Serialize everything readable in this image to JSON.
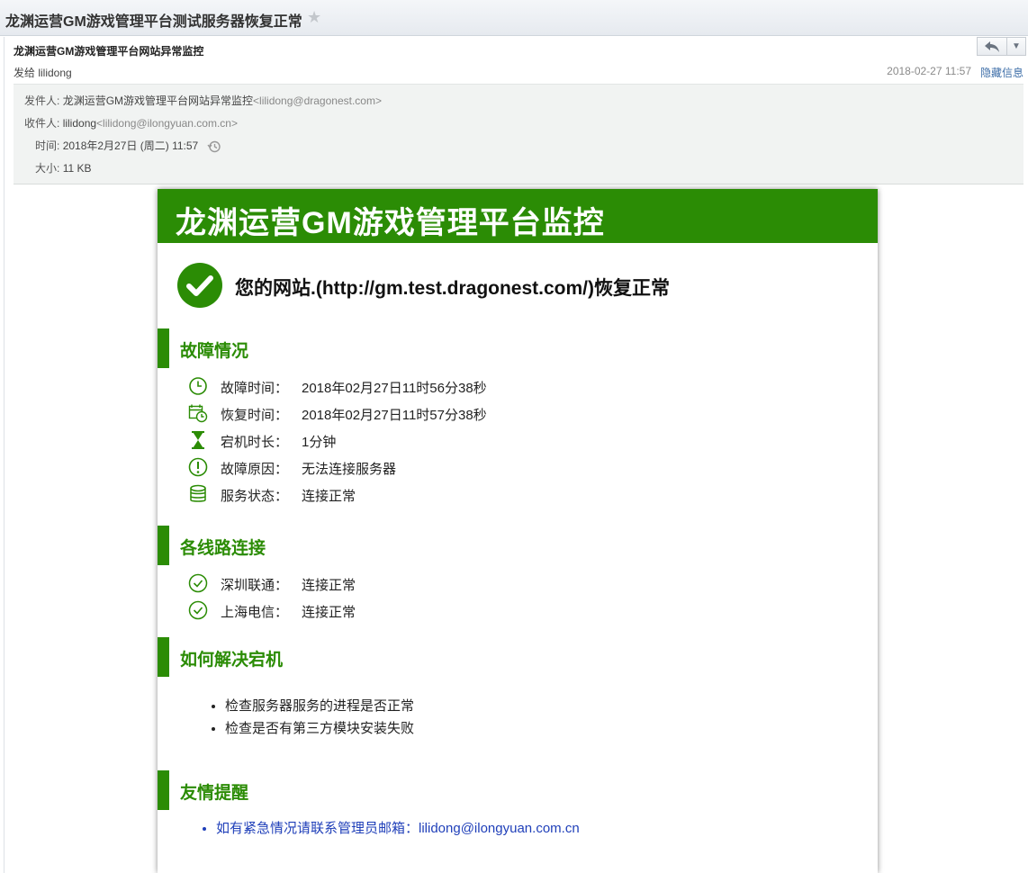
{
  "window": {
    "subject": "龙渊运营GM游戏管理平台测试服务器恢复正常"
  },
  "message": {
    "sender_name": "龙渊运营GM游戏管理平台网站异常监控",
    "recipient_line": "发给 lilidong",
    "date": "2018-02-27 11:57",
    "toggle_details": "隐藏信息"
  },
  "details": {
    "from_label": "发件人:",
    "from_name": "龙渊运营GM游戏管理平台网站异常监控",
    "from_addr": "<lilidong@dragonest.com>",
    "to_label": "收件人:",
    "to_name": "lilidong",
    "to_addr": "<lilidong@ilongyuan.com.cn>",
    "time_label": "时间:",
    "time_value": "2018年2月27日 (周二) 11:57",
    "size_label": "大小:",
    "size_value": "11 KB"
  },
  "body": {
    "banner_title": "龙渊运营GM游戏管理平台监控",
    "status_text": "您的网站.(http://gm.test.dragonest.com/)恢复正常",
    "fault_section": {
      "title": "故障情况",
      "items": [
        {
          "icon": "clock-icon",
          "key": "故障时间：",
          "value": "2018年02月27日11时56分38秒"
        },
        {
          "icon": "calendar-clock-icon",
          "key": "恢复时间：",
          "value": "2018年02月27日11时57分38秒"
        },
        {
          "icon": "hourglass-icon",
          "key": "宕机时长：",
          "value": "1分钟"
        },
        {
          "icon": "exclamation-icon",
          "key": "故障原因：",
          "value": "无法连接服务器"
        },
        {
          "icon": "database-icon",
          "key": "服务状态：",
          "value": "连接正常"
        }
      ]
    },
    "lines_section": {
      "title": "各线路连接",
      "items": [
        {
          "icon": "check-circle-icon",
          "key": "深圳联通：",
          "value": "连接正常"
        },
        {
          "icon": "check-circle-icon",
          "key": "上海电信：",
          "value": "连接正常"
        }
      ]
    },
    "solve_section": {
      "title": "如何解决宕机",
      "items": [
        "检查服务器服务的进程是否正常",
        "检查是否有第三方模块安装失败"
      ]
    },
    "reminder_section": {
      "title": "友情提醒",
      "link_text": "如有紧急情况请联系管理员邮箱：lilidong@ilongyuan.com.cn"
    }
  },
  "colors": {
    "brand_green": "#2b8c05",
    "link_blue": "#1f3fb9"
  }
}
